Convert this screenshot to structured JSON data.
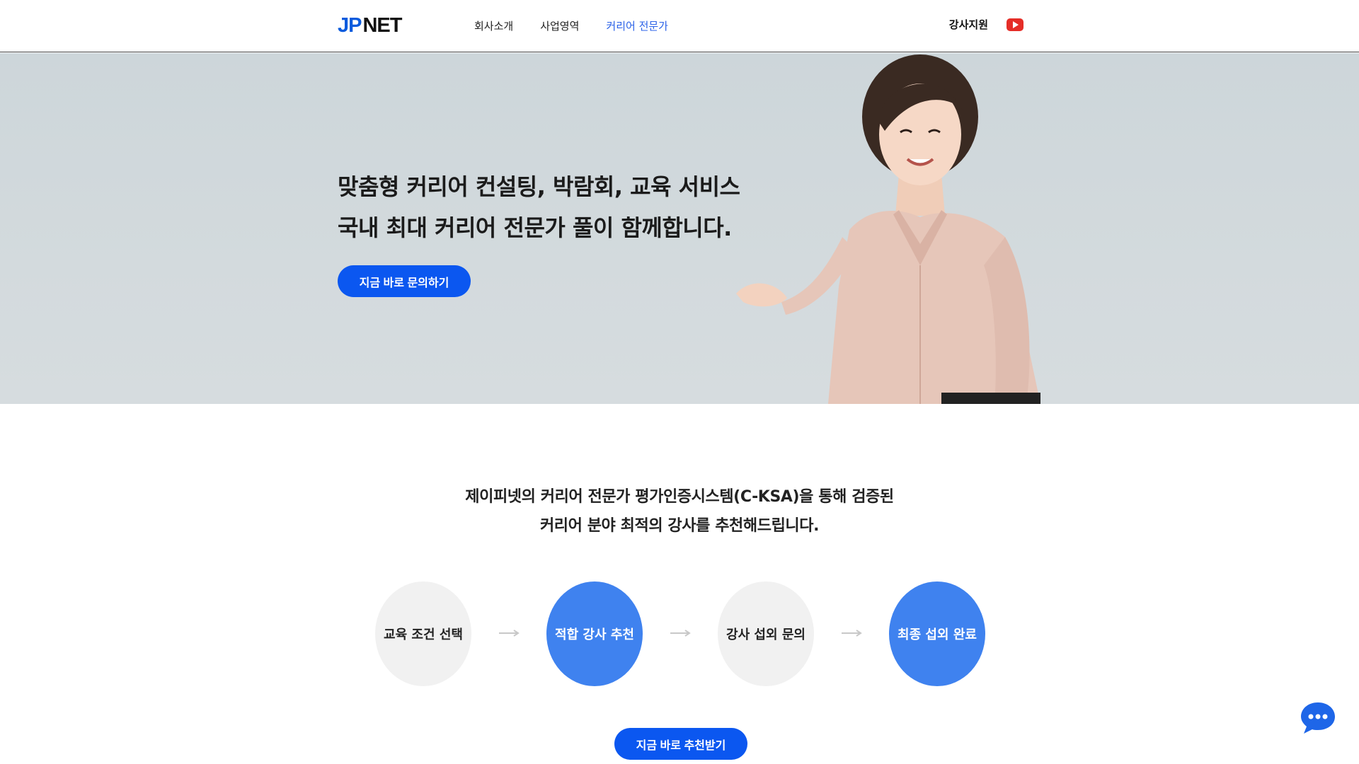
{
  "header": {
    "logo_left": "JP",
    "logo_right": "NET",
    "nav": [
      {
        "label": "회사소개",
        "active": false
      },
      {
        "label": "사업영역",
        "active": false
      },
      {
        "label": "커리어 전문가",
        "active": true
      }
    ],
    "right_link": "강사지원",
    "youtube_icon": "youtube-icon"
  },
  "hero": {
    "line1": "맞춤형 커리어 컨설팅, 박람회, 교육 서비스",
    "line2": "국내 최대 커리어 전문가 풀이 함께합니다.",
    "cta": "지금 바로 문의하기"
  },
  "intro": {
    "line1": "제이피넷의 커리어 전문가 평가인증시스템(C-KSA)을 통해 검증된",
    "line2": "커리어 분야 최적의 강사를 추천해드립니다."
  },
  "steps": [
    {
      "label": "교육 조건 선택",
      "style": "gray"
    },
    {
      "label": "적합 강사 추천",
      "style": "blue"
    },
    {
      "label": "강사 섭외 문의",
      "style": "gray"
    },
    {
      "label": "최종 섭외 완료",
      "style": "blue"
    }
  ],
  "cta2": "지금 바로 추천받기",
  "colors": {
    "accent": "#0b57f0",
    "step_blue": "#3f82ef",
    "step_gray": "#f1f1f1",
    "nav_active": "#2b62e8"
  }
}
